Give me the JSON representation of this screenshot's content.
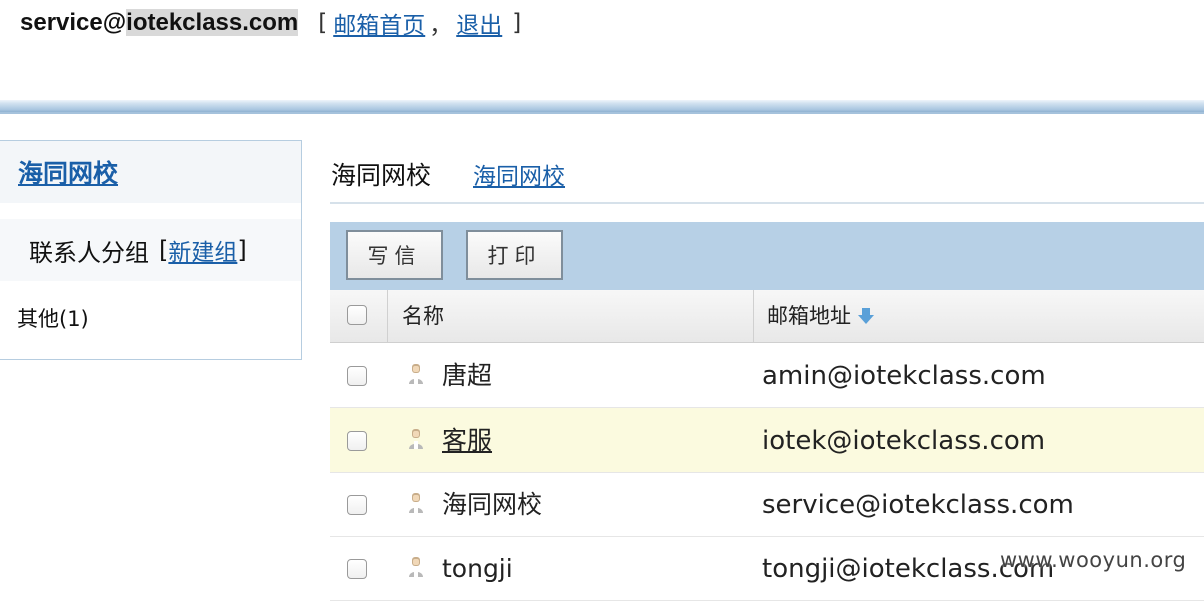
{
  "header": {
    "account_prefix": "service@",
    "account_highlight": "iotekclass.com",
    "bracket_open": "[",
    "bracket_close": "]",
    "home_link": "邮箱首页",
    "separator": "，",
    "logout_link": "退出"
  },
  "sidebar": {
    "title": "海同网校",
    "group_label": "联系人分组",
    "new_group_open": "[",
    "new_group_link": "新建组",
    "new_group_close": "]",
    "other_group": "其他(1)"
  },
  "main": {
    "title": "海同网校",
    "title_link": "海同网校"
  },
  "toolbar": {
    "write_label": "写信",
    "print_label": "打印"
  },
  "table": {
    "col_name": "名称",
    "col_email": "邮箱地址",
    "rows": [
      {
        "name": "唐超",
        "email": "amin@iotekclass.com"
      },
      {
        "name": "客服",
        "email": "iotek@iotekclass.com"
      },
      {
        "name": "海同网校",
        "email": "service@iotekclass.com"
      },
      {
        "name": "tongji",
        "email": "tongji@iotekclass.com"
      }
    ]
  },
  "watermark": "www.wooyun.org",
  "colors": {
    "accent_bar": "#a9c6e0",
    "toolbar_bg": "#b7d0e6",
    "link": "#1a5fa8",
    "row_highlight": "#fbfadf"
  }
}
